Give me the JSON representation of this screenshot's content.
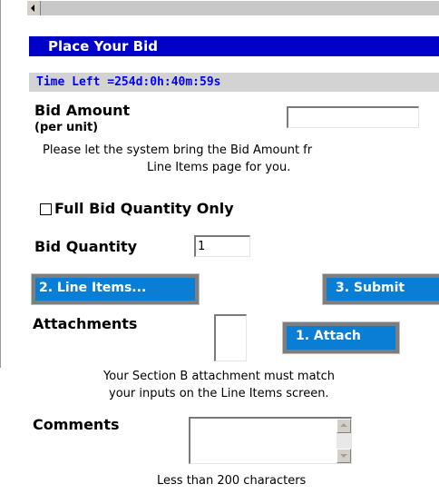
{
  "header": {
    "title": "Place Your Bid"
  },
  "time_left": {
    "text": "Time Left =254d:0h:40m:59s"
  },
  "bid_amount": {
    "label": "Bid Amount",
    "sublabel": "(per unit)",
    "value": "",
    "help_line_1": "Please let the system bring the Bid Amount fr",
    "help_line_2": "Line Items page for you."
  },
  "full_bid_quantity": {
    "label": "Full Bid Quantity Only",
    "checked": false
  },
  "bid_quantity": {
    "label": "Bid Quantity",
    "value": "1"
  },
  "buttons": {
    "line_items": "2. Line Items...",
    "submit": "3.  Submit",
    "attach": "1.  Attach"
  },
  "attachments": {
    "label": "Attachments",
    "note_line_1": "Your Section B attachment must match",
    "note_line_2": "your inputs on the Line Items screen."
  },
  "comments": {
    "label": "Comments",
    "value": "",
    "limit_note": "Less than 200 characters"
  },
  "colors": {
    "header_bg": "#0000c8",
    "time_text": "#0000ff",
    "time_bg": "#d3d3d3",
    "button_bg": "#0a7ed4"
  }
}
